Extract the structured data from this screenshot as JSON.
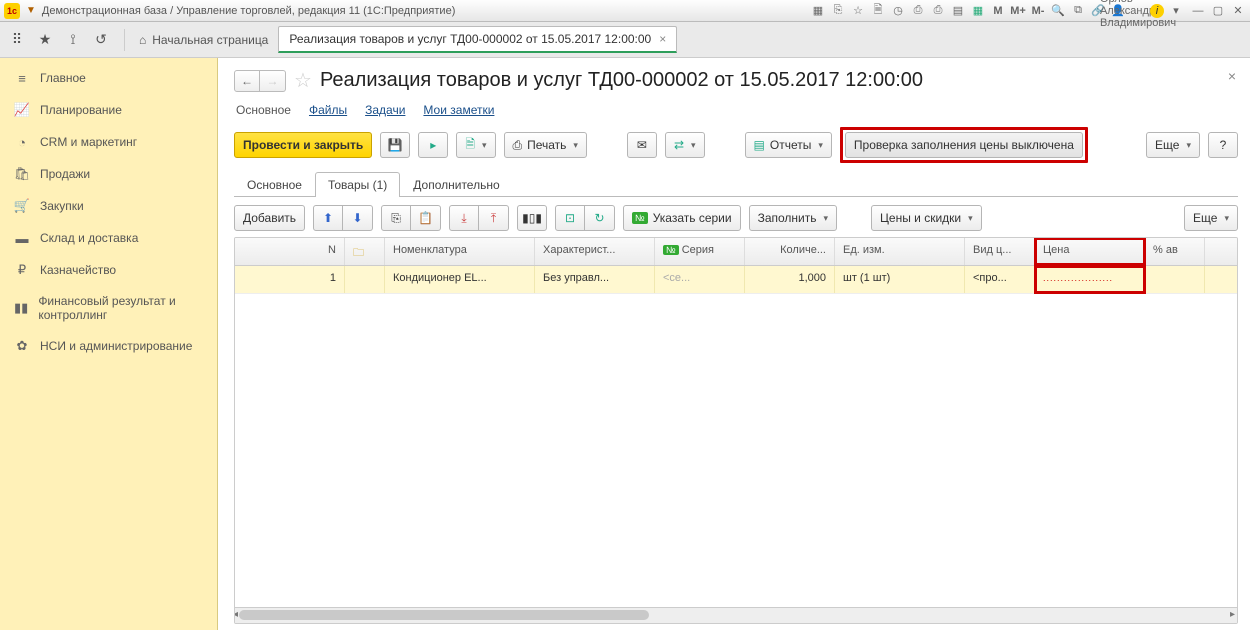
{
  "titlebar": {
    "title": "Демонстрационная база / Управление торговлей, редакция 11  (1С:Предприятие)",
    "user": "Орлов Александр Владимирович",
    "m1": "M",
    "m2": "M+",
    "m3": "M-"
  },
  "tabbar": {
    "home": "Начальная страница",
    "tab": "Реализация товаров и услуг ТД00-000002 от 15.05.2017 12:00:00"
  },
  "sidebar": {
    "items": [
      {
        "label": "Главное"
      },
      {
        "label": "Планирование"
      },
      {
        "label": "CRM и маркетинг"
      },
      {
        "label": "Продажи"
      },
      {
        "label": "Закупки"
      },
      {
        "label": "Склад и доставка"
      },
      {
        "label": "Казначейство"
      },
      {
        "label": "Финансовый результат и контроллинг"
      },
      {
        "label": "НСИ и администрирование"
      }
    ]
  },
  "page": {
    "title": "Реализация товаров и услуг ТД00-000002 от 15.05.2017 12:00:00",
    "links": {
      "main": "Основное",
      "files": "Файлы",
      "tasks": "Задачи",
      "notes": "Мои заметки"
    },
    "buttons": {
      "commit": "Провести и закрыть",
      "print": "Печать",
      "reports": "Отчеты",
      "check": "Проверка заполнения цены выключена",
      "more": "Еще",
      "help": "?"
    },
    "innertabs": {
      "main": "Основное",
      "goods": "Товары (1)",
      "extra": "Дополнительно"
    },
    "tb2": {
      "add": "Добавить",
      "series": "Указать серии",
      "fill": "Заполнить",
      "prices": "Цены и скидки",
      "more": "Еще"
    }
  },
  "table": {
    "headers": {
      "n": "N",
      "nom": "Номенклатура",
      "char": "Характерист...",
      "ser": "Серия",
      "qty": "Количе...",
      "ed": "Ед. изм.",
      "vid": "Вид ц...",
      "price": "Цена",
      "rest": "% ав"
    },
    "icon_ser": "№",
    "rows": [
      {
        "n": "1",
        "nom": "Кондиционер EL...",
        "char": "Без управл...",
        "ser": "<се...",
        "qty": "1,000",
        "ed": "шт (1 шт)",
        "vid": "<про...",
        "price": "...................."
      }
    ]
  }
}
